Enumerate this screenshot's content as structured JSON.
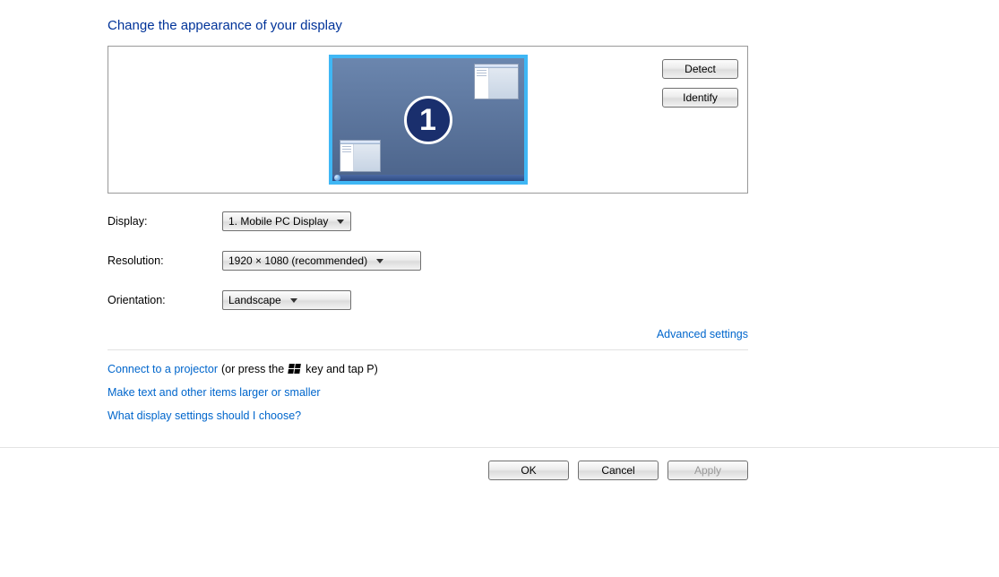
{
  "heading": "Change the appearance of your display",
  "preview": {
    "monitor_number": "1",
    "detect_label": "Detect",
    "identify_label": "Identify"
  },
  "fields": {
    "display": {
      "label": "Display:",
      "value": "1. Mobile PC Display"
    },
    "resolution": {
      "label": "Resolution:",
      "value": "1920 × 1080 (recommended)"
    },
    "orientation": {
      "label": "Orientation:",
      "value": "Landscape"
    }
  },
  "advanced": "Advanced settings",
  "links": {
    "projector_link": "Connect to a projector",
    "projector_suffix_a": " (or press the ",
    "projector_suffix_b": " key and tap P)",
    "text_size": "Make text and other items larger or smaller",
    "help": "What display settings should I choose?"
  },
  "buttons": {
    "ok": "OK",
    "cancel": "Cancel",
    "apply": "Apply"
  }
}
